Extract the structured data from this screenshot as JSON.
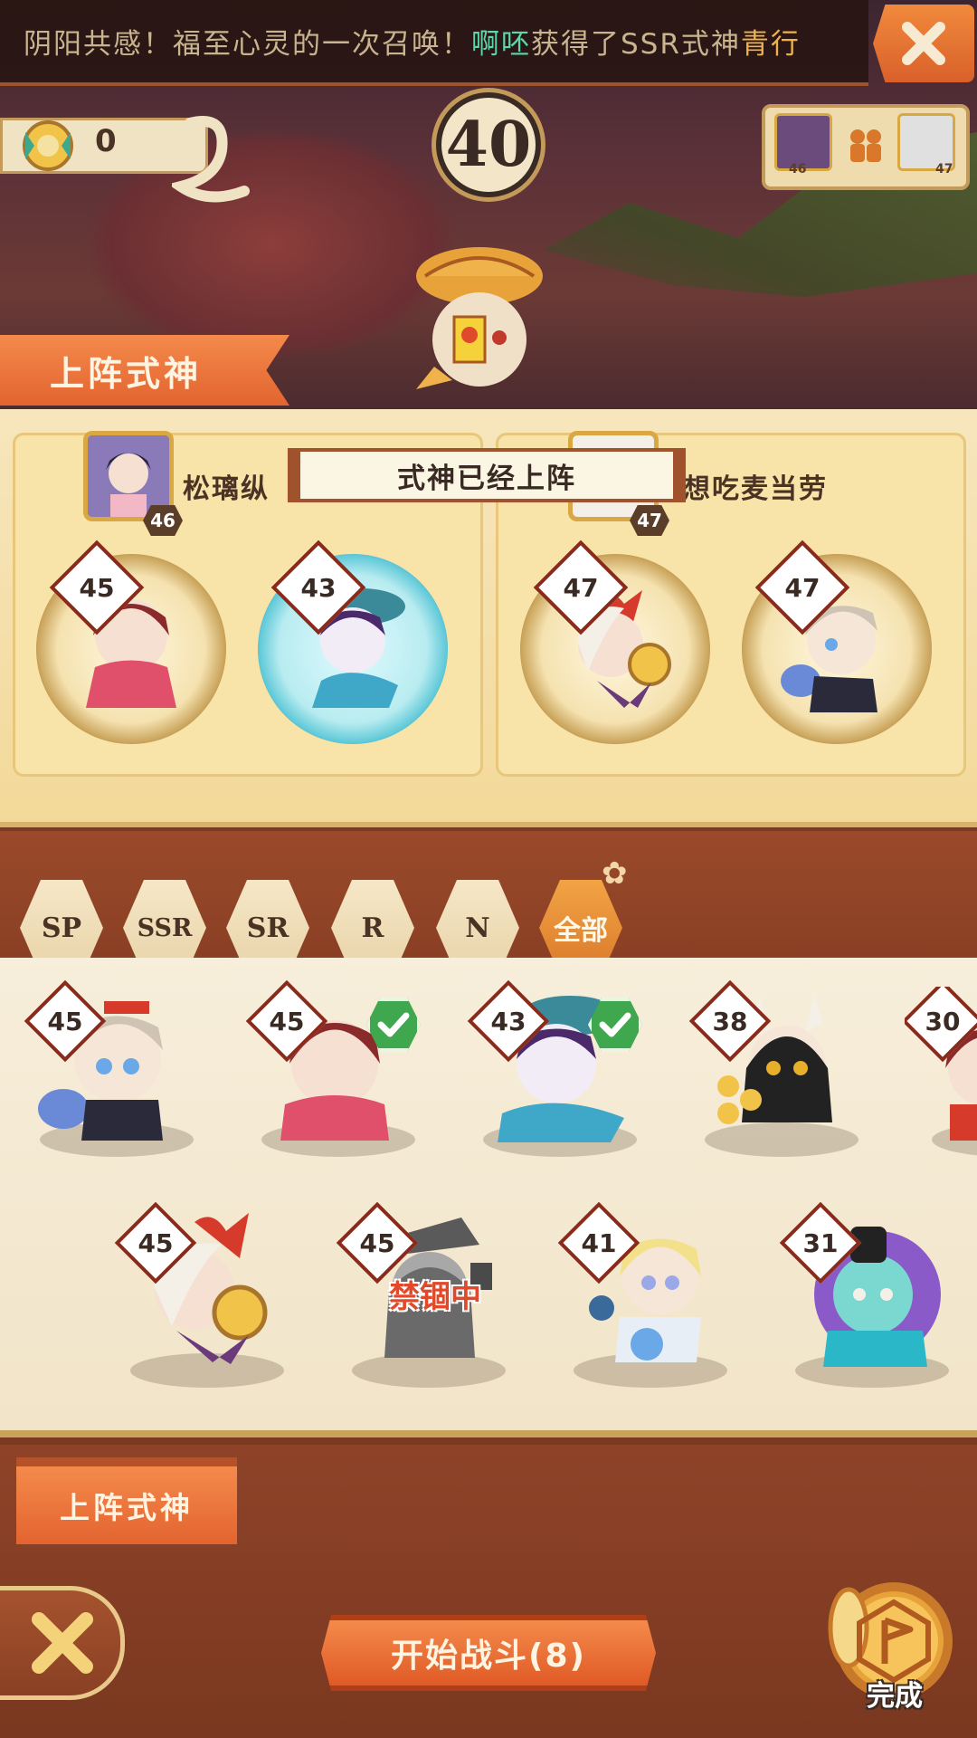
{
  "ticker": {
    "prefix": "阴阳共感！福至心灵的一次召唤！",
    "player": "啊呸",
    "middle": "获得了SSR式神",
    "shikigami": "青行"
  },
  "header": {
    "currency_value": "0",
    "round_number": "40",
    "mini_levels": [
      "46",
      "47"
    ]
  },
  "lineup": {
    "ribbon_label": "上阵式神",
    "banner": "式神已经上阵",
    "players": [
      {
        "name": "松璃纵",
        "level": "46",
        "slots": [
          "45",
          "43"
        ]
      },
      {
        "name": "想吃麦当劳",
        "level": "47",
        "slots": [
          "47",
          "47"
        ]
      }
    ]
  },
  "filters": [
    "SP",
    "SSR",
    "SR",
    "R",
    "N",
    "全部"
  ],
  "active_filter": "全部",
  "roster": {
    "row1": [
      {
        "level": "45",
        "checked": false
      },
      {
        "level": "45",
        "checked": true
      },
      {
        "level": "43",
        "checked": true
      },
      {
        "level": "38",
        "checked": false
      },
      {
        "level": "30",
        "checked": false
      }
    ],
    "row2": [
      {
        "level": "45",
        "status": ""
      },
      {
        "level": "45",
        "status": "禁锢中"
      },
      {
        "level": "41",
        "status": ""
      },
      {
        "level": "31",
        "status": ""
      }
    ]
  },
  "bottom": {
    "ribbon_label": "上阵式神",
    "start_button": "开始战斗(8)",
    "done_label": "完成"
  },
  "colors": {
    "accent_orange": "#e36430",
    "check_green": "#3fa84e",
    "banned_red": "#e04a2a",
    "ticker_green": "#5fd6a8",
    "ticker_gold": "#f0b24a"
  }
}
